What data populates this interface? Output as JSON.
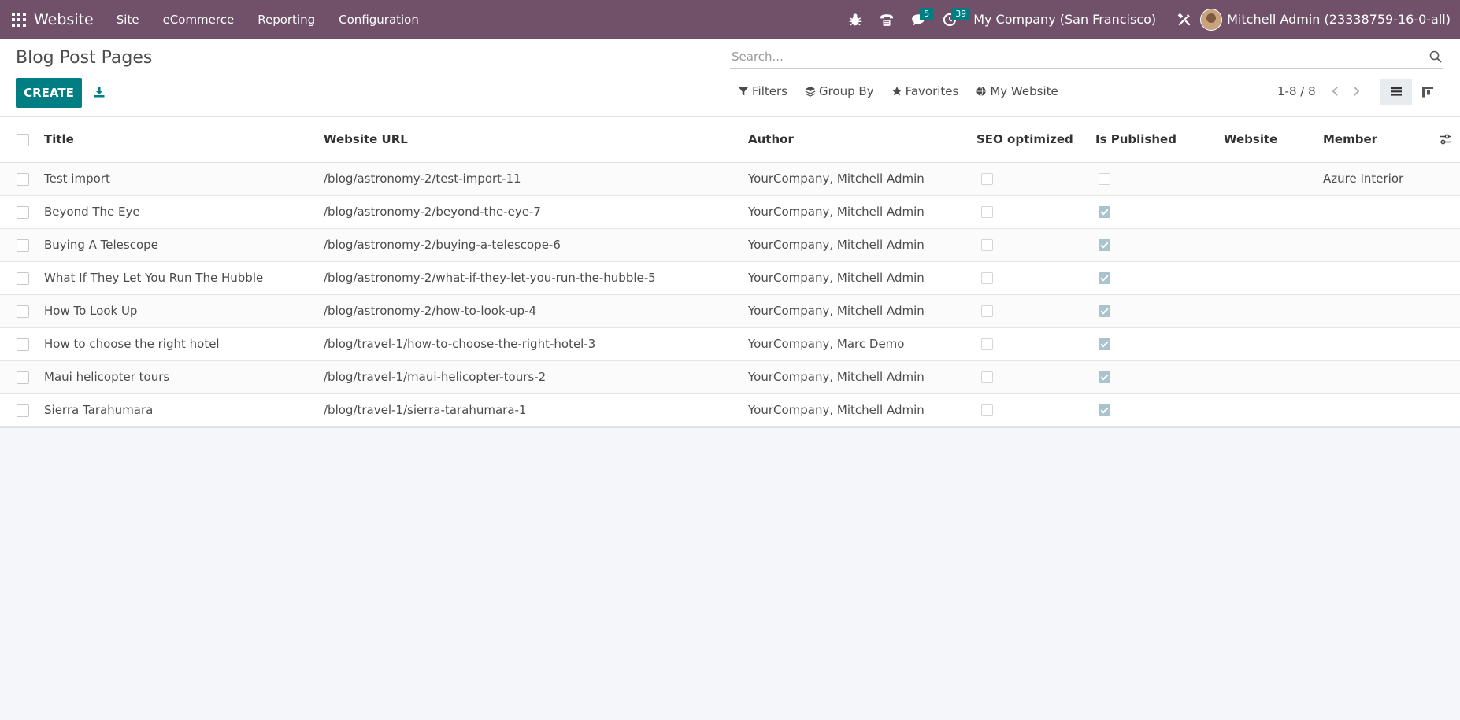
{
  "navbar": {
    "app_name": "Website",
    "menu": [
      "Site",
      "eCommerce",
      "Reporting",
      "Configuration"
    ],
    "messages_count": "5",
    "activities_count": "39",
    "company": "My Company (San Francisco)",
    "user": "Mitchell Admin (23338759-16-0-all)",
    "color": "#71506a"
  },
  "control_panel": {
    "title": "Blog Post Pages",
    "create_label": "CREATE",
    "search_placeholder": "Search...",
    "filters_label": "Filters",
    "groupby_label": "Group By",
    "favorites_label": "Favorites",
    "website_label": "My Website",
    "pager": "1-8 / 8",
    "accent": "#017e84"
  },
  "table": {
    "columns": [
      "Title",
      "Website URL",
      "Author",
      "SEO optimized",
      "Is Published",
      "Website",
      "Member"
    ],
    "rows": [
      {
        "title": "Test import",
        "url": "/blog/astronomy-2/test-import-11",
        "author": "YourCompany, Mitchell Admin",
        "seo": false,
        "published": false,
        "website": "",
        "member": "Azure Interior"
      },
      {
        "title": "Beyond The Eye",
        "url": "/blog/astronomy-2/beyond-the-eye-7",
        "author": "YourCompany, Mitchell Admin",
        "seo": false,
        "published": true,
        "website": "",
        "member": ""
      },
      {
        "title": "Buying A Telescope",
        "url": "/blog/astronomy-2/buying-a-telescope-6",
        "author": "YourCompany, Mitchell Admin",
        "seo": false,
        "published": true,
        "website": "",
        "member": ""
      },
      {
        "title": "What If They Let You Run The Hubble",
        "url": "/blog/astronomy-2/what-if-they-let-you-run-the-hubble-5",
        "author": "YourCompany, Mitchell Admin",
        "seo": false,
        "published": true,
        "website": "",
        "member": ""
      },
      {
        "title": "How To Look Up",
        "url": "/blog/astronomy-2/how-to-look-up-4",
        "author": "YourCompany, Mitchell Admin",
        "seo": false,
        "published": true,
        "website": "",
        "member": ""
      },
      {
        "title": "How to choose the right hotel",
        "url": "/blog/travel-1/how-to-choose-the-right-hotel-3",
        "author": "YourCompany, Marc Demo",
        "seo": false,
        "published": true,
        "website": "",
        "member": ""
      },
      {
        "title": "Maui helicopter tours",
        "url": "/blog/travel-1/maui-helicopter-tours-2",
        "author": "YourCompany, Mitchell Admin",
        "seo": false,
        "published": true,
        "website": "",
        "member": ""
      },
      {
        "title": "Sierra Tarahumara",
        "url": "/blog/travel-1/sierra-tarahumara-1",
        "author": "YourCompany, Mitchell Admin",
        "seo": false,
        "published": true,
        "website": "",
        "member": ""
      }
    ]
  }
}
